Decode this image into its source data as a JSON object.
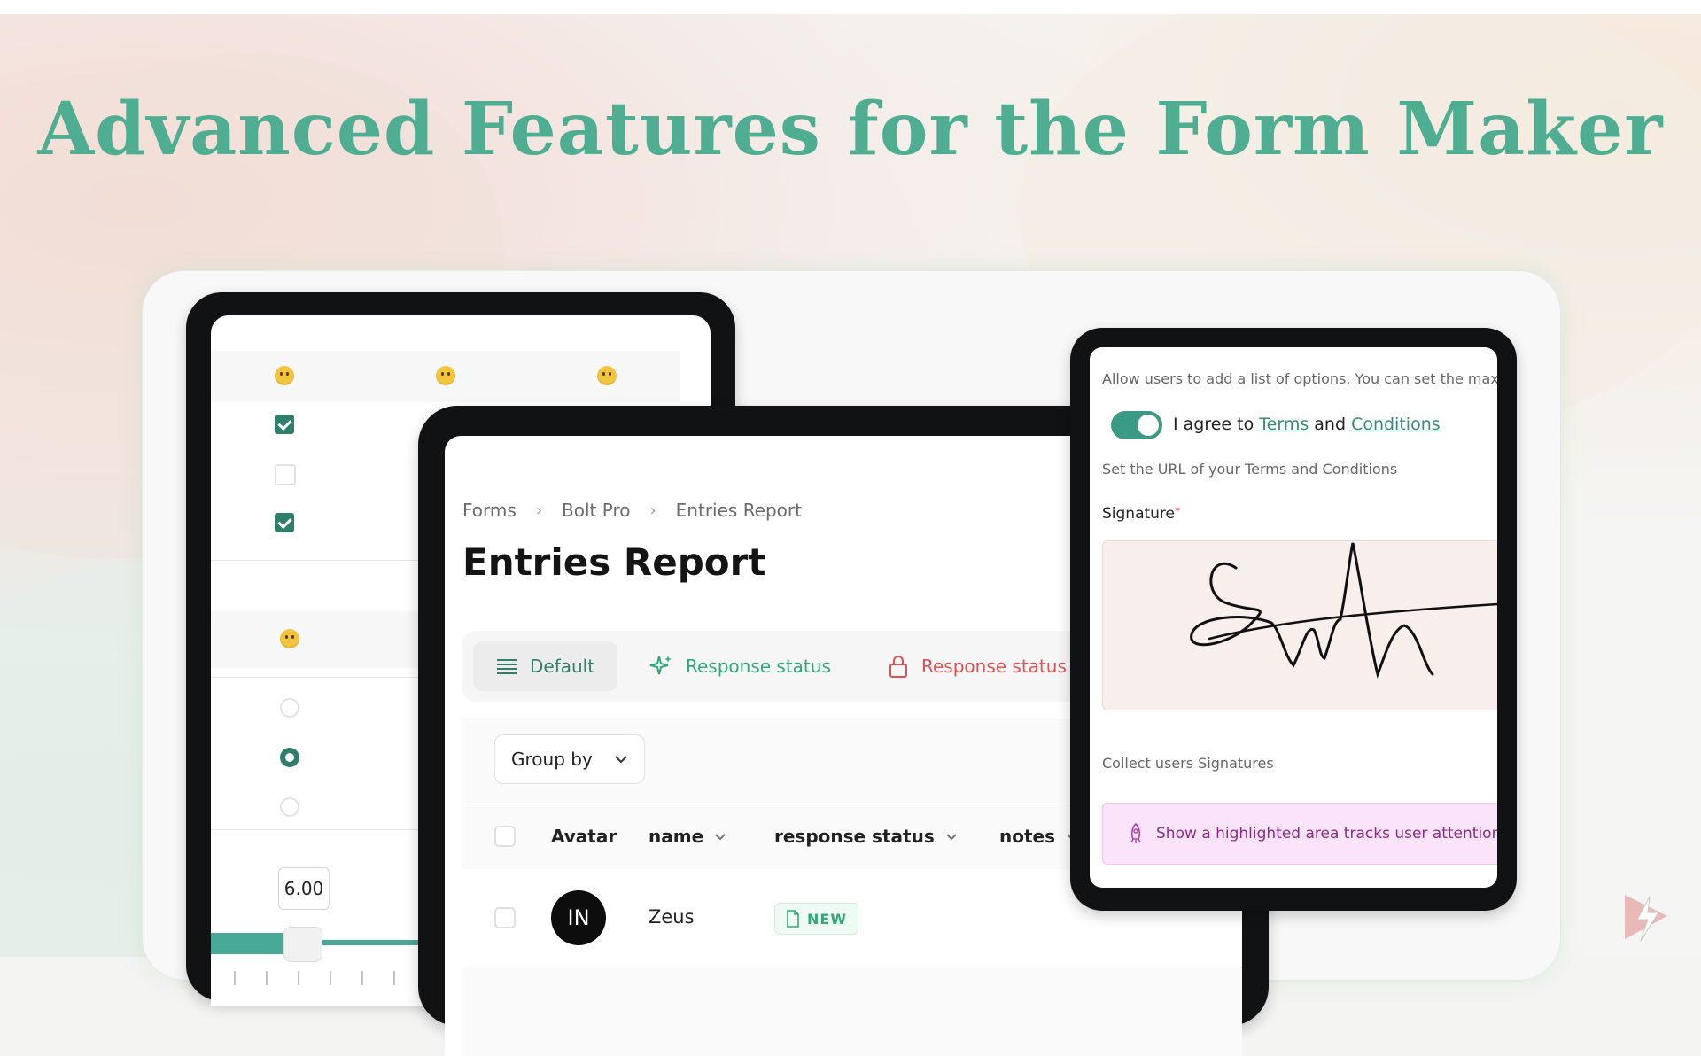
{
  "title": "Advanced Features for the Form Maker",
  "left_tablet": {
    "number_value": "6.00"
  },
  "entries": {
    "breadcrumb": [
      "Forms",
      "Bolt Pro",
      "Entries Report"
    ],
    "page_title": "Entries Report",
    "views": {
      "default": "Default",
      "response_status_green": "Response status",
      "response_status_red": "Response status"
    },
    "group_by": "Group by",
    "columns": {
      "avatar": "Avatar",
      "name": "name",
      "response_status": "response status",
      "notes": "notes"
    },
    "rows": [
      {
        "avatar_initials": "IN",
        "name": "Zeus",
        "status": "NEW"
      }
    ]
  },
  "settings": {
    "options_help": "Allow users to add a list of options. You can set the maxi",
    "agree_prefix": "I agree to ",
    "terms": "Terms",
    "and": " and ",
    "conditions": "Conditions",
    "terms_help": "Set the URL of your Terms and Conditions",
    "signature_label": "Signature",
    "required_mark": "*",
    "collect_help": "Collect users Signatures",
    "highlight_text": "Show a highlighted area tracks user attention"
  },
  "colors": {
    "accent": "#4fae92",
    "toggle": "#3a9a86",
    "status_green": "#2fa97a",
    "status_red": "#e05252"
  }
}
